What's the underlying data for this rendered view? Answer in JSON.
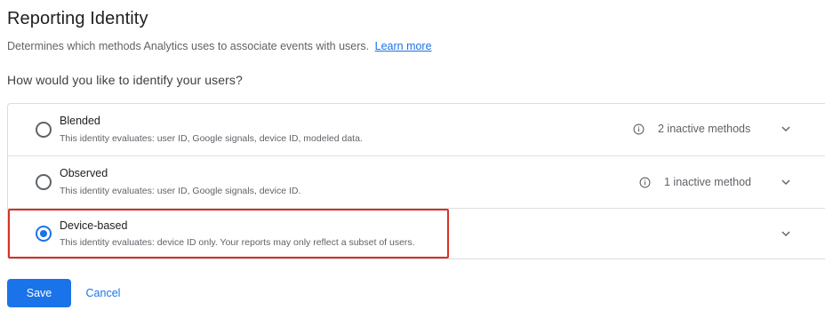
{
  "header": {
    "title": "Reporting Identity",
    "description": "Determines which methods Analytics uses to associate events with users.",
    "learn_more": "Learn more"
  },
  "question": "How would you like to identify your users?",
  "options": [
    {
      "title": "Blended",
      "description": "This identity evaluates: user ID, Google signals, device ID, modeled data.",
      "inactive": "2 inactive methods",
      "selected": false
    },
    {
      "title": "Observed",
      "description": "This identity evaluates: user ID, Google signals, device ID.",
      "inactive": "1 inactive method",
      "selected": false
    },
    {
      "title": "Device-based",
      "description": "This identity evaluates: device ID only. Your reports may only reflect a subset of users.",
      "inactive": "",
      "selected": true
    }
  ],
  "actions": {
    "save": "Save",
    "cancel": "Cancel"
  },
  "colors": {
    "accent": "#1a73e8",
    "highlight": "#d93025"
  },
  "icons": {
    "info": "info-icon",
    "expand": "chevron-down-icon"
  }
}
